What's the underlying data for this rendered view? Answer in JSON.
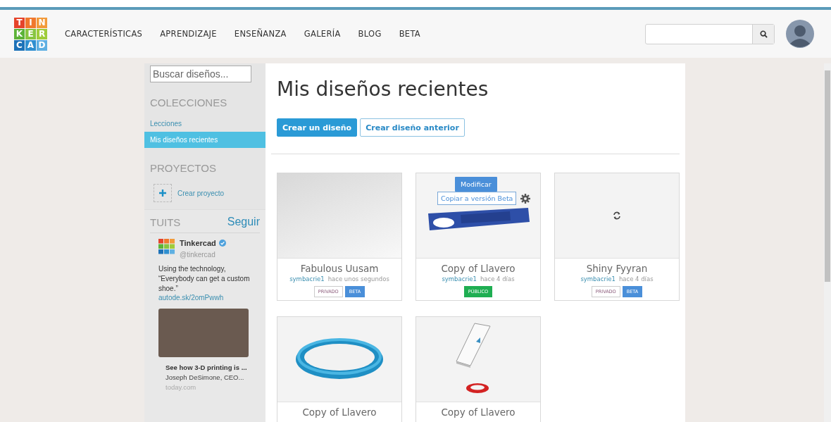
{
  "header": {
    "logo": [
      {
        "letter": "T",
        "color": "#e5432a"
      },
      {
        "letter": "I",
        "color": "#f0782d"
      },
      {
        "letter": "N",
        "color": "#f29a3a"
      },
      {
        "letter": "K",
        "color": "#5cb338"
      },
      {
        "letter": "E",
        "color": "#87c540"
      },
      {
        "letter": "R",
        "color": "#9fcc3b"
      },
      {
        "letter": "C",
        "color": "#1d72b8"
      },
      {
        "letter": "A",
        "color": "#2f8fd0"
      },
      {
        "letter": "D",
        "color": "#5fb0e2"
      }
    ],
    "nav": [
      "CARACTERÍSTICAS",
      "APRENDIZAJE",
      "ENSEÑANZA",
      "GALERÍA",
      "BLOG",
      "BETA"
    ]
  },
  "sidebar": {
    "search_placeholder": "Buscar diseños...",
    "collections_heading": "COLECCIONES",
    "collections": [
      {
        "label": "Lecciones",
        "selected": false
      },
      {
        "label": "Mis diseños recientes",
        "selected": true
      }
    ],
    "projects_heading": "PROYECTOS",
    "create_project": "Crear proyecto",
    "tweets_heading": "TUITS",
    "follow": "Seguir",
    "tweet": {
      "name": "Tinkercad",
      "handle": "@tinkercad",
      "text": "Using the technology, “Everybody can get a custom shoe.”",
      "link": "autode.sk/2omPwwh",
      "card_title": "See how 3-D printing is ...",
      "card_description": "Joseph DeSimone, CEO...",
      "card_domain": "today.com"
    }
  },
  "main": {
    "title": "Mis diseños recientes",
    "buttons": [
      {
        "label": "Crear un diseño",
        "kind": "primary"
      },
      {
        "label": "Crear diseño anterior",
        "kind": "secondary"
      }
    ],
    "designs": [
      {
        "name": "Fabulous Uusam",
        "author": "symbacrie1",
        "time": "hace unos segundos",
        "kind": "blank",
        "badges": [
          {
            "label": "PRIVADO",
            "kind": "private"
          },
          {
            "label": "BETA",
            "kind": "beta"
          }
        ]
      },
      {
        "name": "Copy of Llavero",
        "author": "symbacrie1",
        "time": "hace 4 días",
        "kind": "keychain",
        "badges": [
          {
            "label": "PÚBLICO",
            "kind": "public"
          }
        ],
        "overlay": {
          "modify": "Modificar",
          "copy": "Copiar a versión Beta"
        }
      },
      {
        "name": "Shiny Fyyran",
        "author": "symbacrie1",
        "time": "hace 4 días",
        "kind": "loading",
        "badges": [
          {
            "label": "PRIVADO",
            "kind": "private"
          },
          {
            "label": "BETA",
            "kind": "beta"
          }
        ]
      },
      {
        "name": "Copy of Llavero",
        "kind": "ring"
      },
      {
        "name": "Copy of Llavero",
        "kind": "plate"
      }
    ]
  }
}
